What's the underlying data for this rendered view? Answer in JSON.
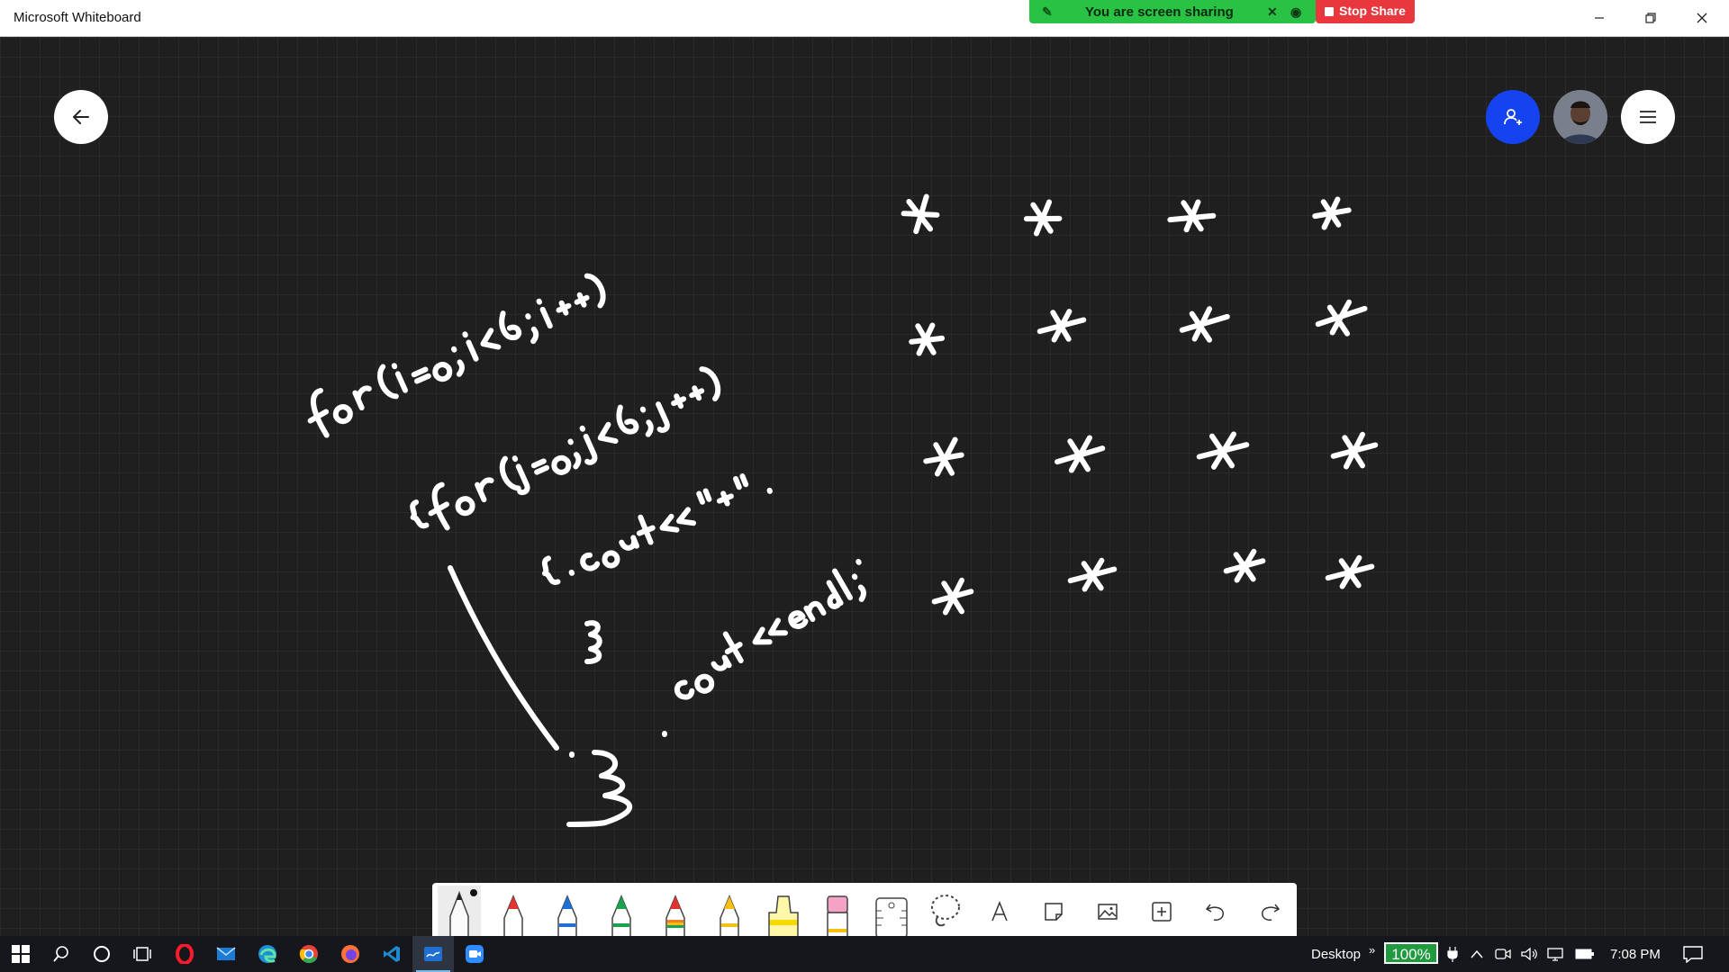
{
  "window": {
    "title": "Microsoft Whiteboard",
    "controls": [
      "minimize",
      "restore",
      "close"
    ]
  },
  "screen_share": {
    "status_text": "You are screen sharing",
    "stop_label": "Stop Share",
    "status_color": "#29c245",
    "stop_color": "#e8373d"
  },
  "canvas": {
    "background": "#1f1f1f",
    "back_button_icon": "arrow-left-icon",
    "invite_button_icon": "add-person-icon",
    "avatar": "user-avatar",
    "menu_button_icon": "hamburger-menu-icon"
  },
  "toolbar": {
    "tools": [
      {
        "name": "pen-white",
        "color": "#ffffff",
        "active": true
      },
      {
        "name": "pen-red",
        "color": "#e0342f"
      },
      {
        "name": "pen-blue",
        "color": "#1d6fd6"
      },
      {
        "name": "pen-green",
        "color": "#19a34a"
      },
      {
        "name": "pen-rainbow",
        "color": "#ef7d2b"
      },
      {
        "name": "pen-yellow",
        "color": "#f5c013"
      },
      {
        "name": "highlighter",
        "color": "#fff06b"
      },
      {
        "name": "eraser",
        "color": "#f4a3c6"
      },
      {
        "name": "ruler"
      },
      {
        "name": "lasso"
      },
      {
        "name": "text",
        "glyph": "A"
      },
      {
        "name": "note"
      },
      {
        "name": "image"
      },
      {
        "name": "insert"
      },
      {
        "name": "undo"
      },
      {
        "name": "redo"
      }
    ]
  },
  "taskbar": {
    "apps": [
      "start",
      "search",
      "cortana",
      "task-view",
      "opera",
      "mail",
      "edge",
      "chrome",
      "firefox",
      "vscode",
      "whiteboard",
      "zoom"
    ],
    "desktop_label": "Desktop",
    "chevron": "»",
    "battery_percent": "100%",
    "time": "7:08 PM"
  }
}
